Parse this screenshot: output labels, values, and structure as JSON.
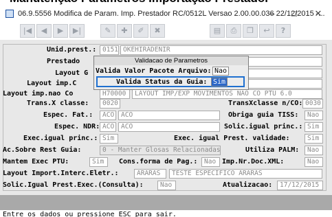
{
  "banner": "Manutenção Parametros Importação Prestador",
  "window": {
    "title": "06.9.5556  Modifica de Param. Imp. Prestador RC/0512L Versao 2.00.00.036 22/12/2015 -...",
    "minimize": "–",
    "maximize": "□",
    "close": "✕"
  },
  "toolbar": {
    "buttons": [
      "first-icon",
      "prev-icon",
      "next-icon",
      "last-icon",
      "tools-icon",
      "add-icon",
      "edit-icon",
      "delete-icon",
      "print-preview-icon",
      "print-icon",
      "copy-icon",
      "exit-icon",
      "help-icon"
    ],
    "help_label": "?"
  },
  "form": {
    "unid_prest": {
      "label": "Unid.prest.:",
      "code": "0151",
      "name": "OKEHIRADENIR"
    },
    "prestado": {
      "label": "Prestado"
    },
    "layout_g": {
      "label": "Layout G"
    },
    "layout_imp_c": {
      "label": "Layout imp.C"
    },
    "layout_imp_nao": {
      "label": "Layout imp.nao Co",
      "code": "H70000",
      "value": "LAYOUT IMP/EXP MOVIMENTOS NAO CO PTU 6.0"
    },
    "trans_x": {
      "label": "Trans.X classe:",
      "value": "0020"
    },
    "transxclasse": {
      "label": "TransXclasse n/CO:",
      "value": "0030"
    },
    "espec_fat": {
      "label": "Espec. Fat.:",
      "code": "ACO",
      "value": "ACO"
    },
    "obriga_tiss": {
      "label": "Obriga guia TISS:",
      "value": "Nao"
    },
    "espec_ndr": {
      "label": "Espec. NDR:",
      "code": "ACO",
      "value": "ACO"
    },
    "solic_igual": {
      "label": "Solic.igual princ.:",
      "value": "Sim"
    },
    "exec_igual": {
      "label": "Exec.igual princ.:",
      "value": "Sim"
    },
    "exec_igual_prest": {
      "label": "Exec. igual Prest. validade:",
      "value": "Sim"
    },
    "ac_sobre": {
      "label": "Ac.Sobre Rest Guia:",
      "value": "0 - Manter Glosas Relacionadas"
    },
    "utiliza_palm": {
      "label": "Utiliza PALM:",
      "value": "Nao"
    },
    "mantem_exec": {
      "label": "Mantem Exec PTU:",
      "value": "Sim"
    },
    "cons_forma": {
      "label": "Cons.forma de Pag.:",
      "value": "Nao"
    },
    "imp_nr_doc": {
      "label": "Imp.Nr.Doc.XML:",
      "value": "Nao"
    },
    "layout_import": {
      "label": "Layout Import.Interc.Eletr.:",
      "code": "ARARAS",
      "value": "TESTE ESPECIFICO ARARAS"
    },
    "solic_igual_exec": {
      "label": "Solic.Igual Prest.Exec.(Consulta):",
      "value": "Nao"
    },
    "atualizacao": {
      "label": "Atualizacao:",
      "value": "17/12/2015"
    }
  },
  "dialog": {
    "title": "Validacao de Parametros",
    "valida_pacote": {
      "label": "Valida Valor Pacote Arquivo:",
      "value": "Nao"
    },
    "valida_status": {
      "label": "Valida Status da Guia:",
      "value": "Sim"
    }
  },
  "status": {
    "text": "Entre os dados ou pressione ESC para sair."
  }
}
